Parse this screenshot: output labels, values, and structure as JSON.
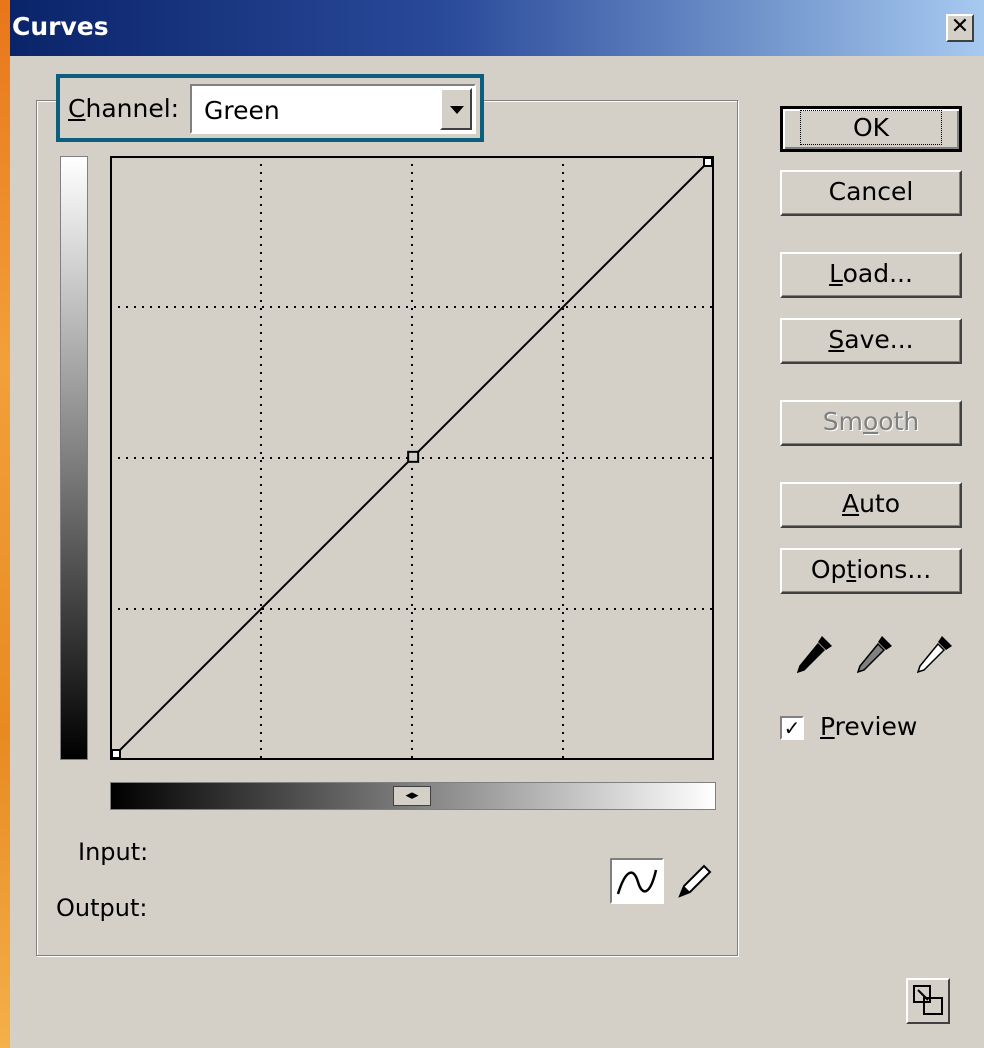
{
  "window": {
    "title": "Curves",
    "close_glyph": "✕"
  },
  "channel": {
    "label_prefix": "C",
    "label_rest": "hannel:",
    "selected": "Green"
  },
  "curve": {
    "points": [
      [
        0,
        0
      ],
      [
        128,
        128
      ],
      [
        255,
        255
      ]
    ],
    "input_range": [
      0,
      255
    ],
    "output_range": [
      0,
      255
    ],
    "grid_divisions": 4
  },
  "io": {
    "input_label": "Input:",
    "output_label": "Output:"
  },
  "buttons": {
    "ok": "OK",
    "cancel": "Cancel",
    "load": {
      "pre": "",
      "ul": "L",
      "post": "oad..."
    },
    "save": {
      "pre": "",
      "ul": "S",
      "post": "ave..."
    },
    "smooth": {
      "pre": "Sm",
      "ul": "o",
      "post": "oth"
    },
    "auto": {
      "pre": "",
      "ul": "A",
      "post": "uto"
    },
    "options": {
      "pre": "Op",
      "ul": "t",
      "post": "ions..."
    }
  },
  "eyedroppers": [
    "black-point-eyedropper-icon",
    "gray-point-eyedropper-icon",
    "white-point-eyedropper-icon"
  ],
  "preview": {
    "checked": true,
    "check_glyph": "✓",
    "label_prefix": "P",
    "label_rest": "review"
  },
  "gradient_toggle": "◂▸",
  "colors": {
    "title_start": "#0a246a",
    "title_end": "#a6caf0",
    "dialog_bg": "#d4d0c8",
    "highlight": "#0b5e7e"
  }
}
